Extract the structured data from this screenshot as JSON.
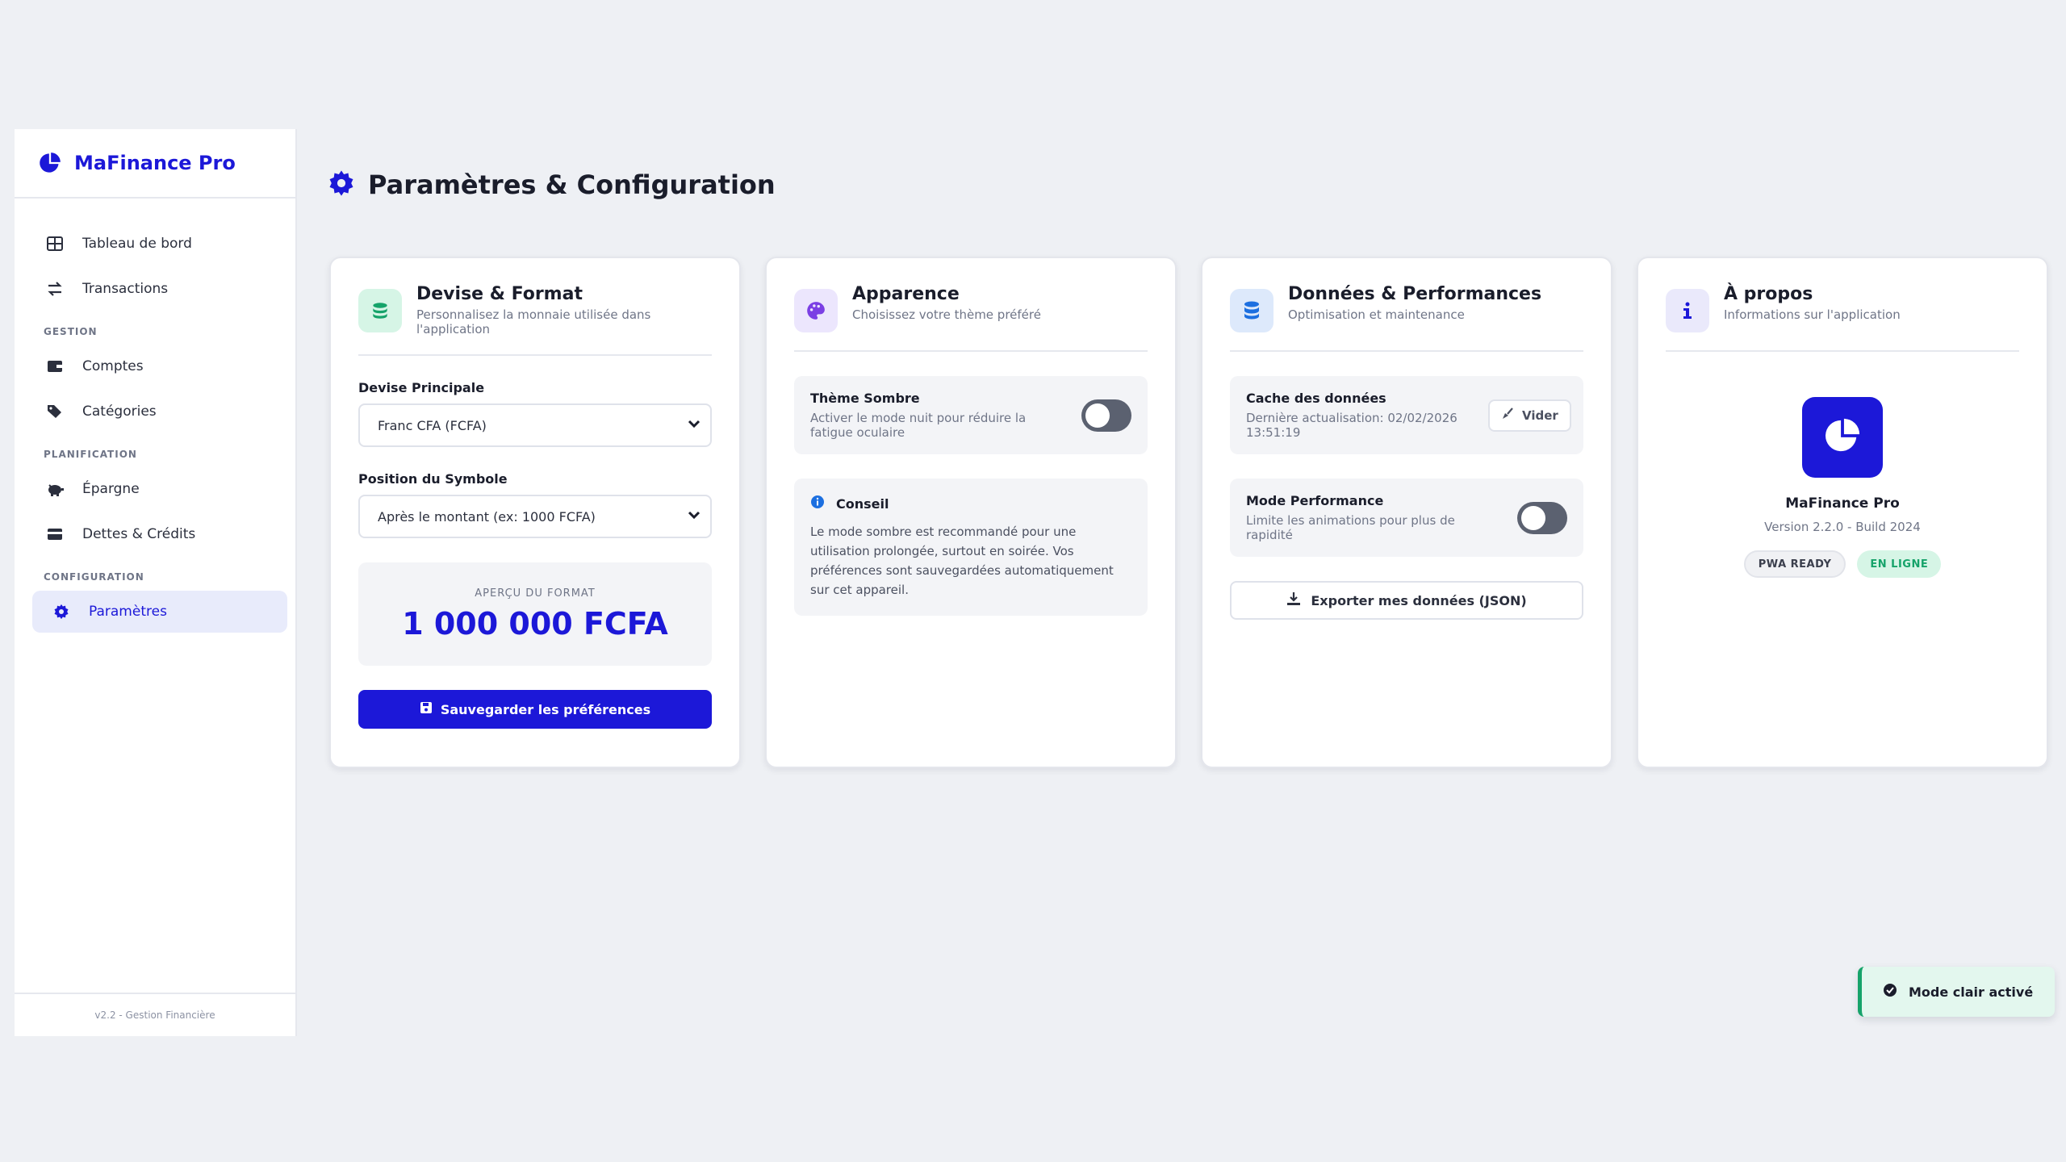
{
  "brand": {
    "title": "MaFinance Pro",
    "icon": "pie-chart-icon"
  },
  "sidebar": {
    "items_top": [
      {
        "label": "Tableau de bord",
        "icon": "grid-icon"
      },
      {
        "label": "Transactions",
        "icon": "swap-icon"
      }
    ],
    "sections": [
      {
        "title": "GESTION",
        "items": [
          {
            "label": "Comptes",
            "icon": "wallet-icon"
          },
          {
            "label": "Catégories",
            "icon": "tags-icon"
          }
        ]
      },
      {
        "title": "PLANIFICATION",
        "items": [
          {
            "label": "Épargne",
            "icon": "piggy-bank-icon"
          },
          {
            "label": "Dettes & Crédits",
            "icon": "credit-card-icon"
          }
        ]
      },
      {
        "title": "CONFIGURATION",
        "items": [
          {
            "label": "Paramètres",
            "icon": "gear-icon",
            "active": true
          }
        ]
      }
    ],
    "footer": "v2.2 - Gestion Financière"
  },
  "page": {
    "title": "Paramètres & Configuration"
  },
  "currency_card": {
    "title": "Devise & Format",
    "subtitle": "Personnalisez la monnaie utilisée dans l'application",
    "currency_label": "Devise Principale",
    "currency_value": "Franc CFA (FCFA)",
    "position_label": "Position du Symbole",
    "position_value": "Après le montant (ex: 1000 FCFA)",
    "preview_label": "APERÇU DU FORMAT",
    "preview_value": "1 000 000 FCFA",
    "save_label": "Sauvegarder les préférences"
  },
  "appearance_card": {
    "title": "Apparence",
    "subtitle": "Choisissez votre thème préféré",
    "dark_title": "Thème Sombre",
    "dark_desc": "Activer le mode nuit pour réduire la fatigue oculaire",
    "dark_enabled": false,
    "tip_title": "Conseil",
    "tip_text": "Le mode sombre est recommandé pour une utilisation prolongée, surtout en soirée. Vos préférences sont sauvegardées automatiquement sur cet appareil."
  },
  "data_card": {
    "title": "Données & Performances",
    "subtitle": "Optimisation et maintenance",
    "cache_title": "Cache des données",
    "cache_desc": "Dernière actualisation: 02/02/2026 13:51:19",
    "clear_label": "Vider",
    "perf_title": "Mode Performance",
    "perf_desc": "Limite les animations pour plus de rapidité",
    "perf_enabled": false,
    "export_label": "Exporter mes données (JSON)"
  },
  "about_card": {
    "title": "À propos",
    "subtitle": "Informations sur l'application",
    "app_name": "MaFinance Pro",
    "version": "Version 2.2.0 - Build 2024",
    "badge_pwa": "PWA READY",
    "badge_online": "EN LIGNE"
  },
  "toast": {
    "text": "Mode clair activé"
  },
  "colors": {
    "accent": "#1c18d8",
    "success": "#16a36a"
  }
}
